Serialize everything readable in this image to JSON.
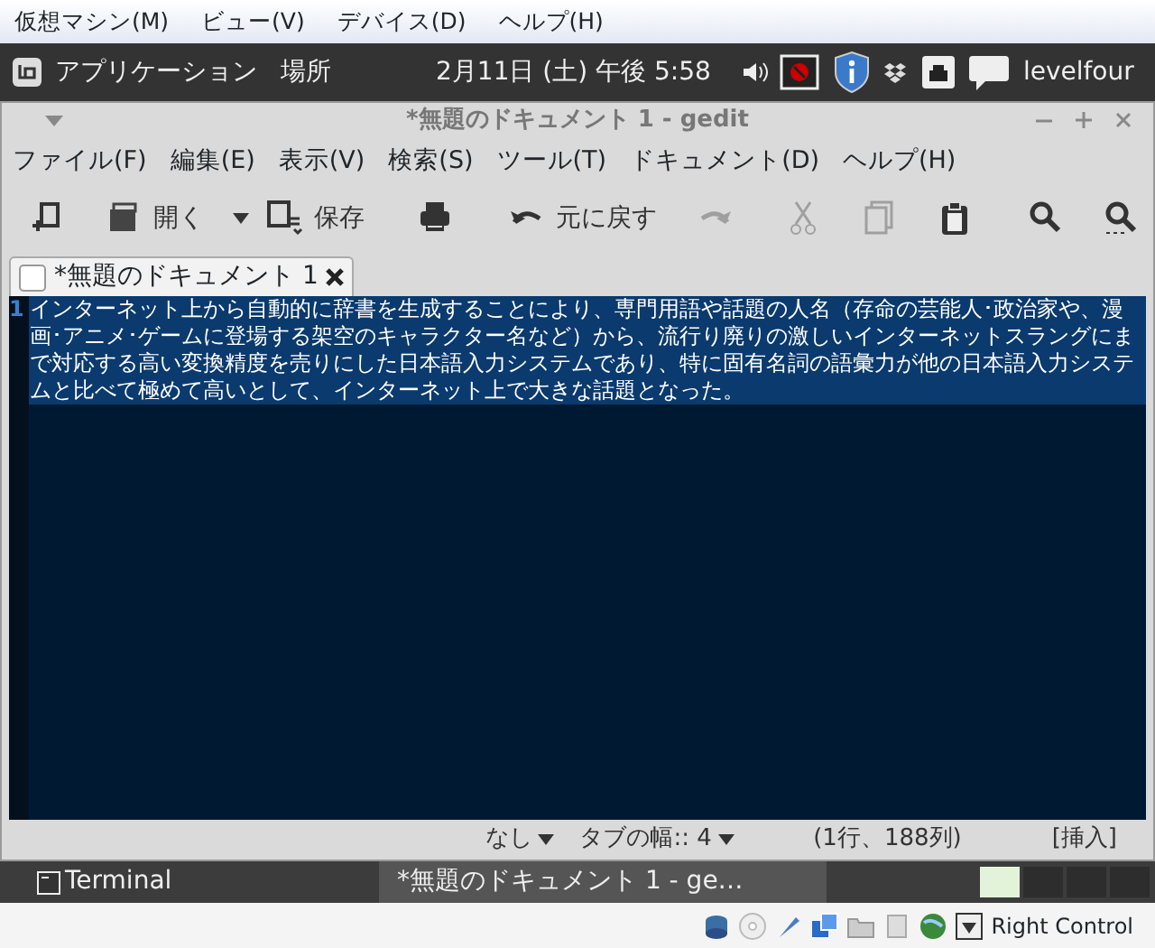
{
  "vm_menu": [
    "仮想マシン(M)",
    "ビュー(V)",
    "デバイス(D)",
    "ヘルプ(H)"
  ],
  "panel": {
    "apps": "アプリケーション",
    "places": "場所",
    "clock": "2月11日 (土) 午後 5:58",
    "user": "levelfour"
  },
  "window": {
    "title": "*無題のドキュメント 1 - gedit"
  },
  "menu": [
    "ファイル(F)",
    "編集(E)",
    "表示(V)",
    "検索(S)",
    "ツール(T)",
    "ドキュメント(D)",
    "ヘルプ(H)"
  ],
  "toolbar": [
    {
      "disabled": false
    },
    {
      "label": "開く",
      "disabled": false
    },
    {
      "label": "保存",
      "disabled": false
    },
    {
      "disabled": false
    },
    {
      "label": "元に戻す",
      "disabled": false
    },
    {
      "disabled": true
    },
    {
      "disabled": true
    },
    {
      "disabled": true
    },
    {
      "disabled": false
    },
    {
      "disabled": false
    },
    {
      "disabled": false
    }
  ],
  "tabs": [
    {
      "label": "*無題のドキュメント 1",
      "selected": true
    }
  ],
  "editor": {
    "line_number": "1",
    "text": "インターネット上から自動的に辞書を生成することにより、専門用語や話題の人名（存命の芸能人･政治家や、漫画･アニメ･ゲームに登場する架空のキャラクター名など）から、流行り廃りの激しいインターネットスラングにまで対応する高い変換精度を売りにした日本語入力システムであり、特に固有名詞の語彙力が他の日本語入力システムと比べて極めて高いとして、インターネット上で大きな話題となった。",
    "selected": true
  },
  "status_bar": {
    "syntax": "なし",
    "tab_width": "タブの幅:: 4",
    "position": "(1行、188列)",
    "mode": "[挿入]"
  },
  "taskbar": [
    {
      "label": "Terminal",
      "selected": false
    },
    {
      "label": "*無題のドキュメント 1 - ge…",
      "selected": true
    }
  ],
  "workspaces": [
    {
      "selected": true
    },
    {
      "selected": false
    },
    {
      "selected": false
    },
    {
      "selected": false
    }
  ],
  "vm_status": {
    "host_key": "Right Control"
  }
}
